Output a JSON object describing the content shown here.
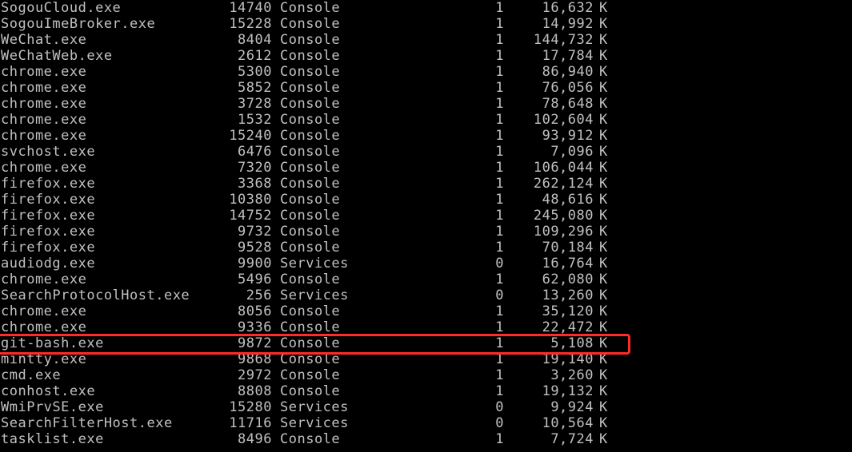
{
  "console": {
    "rows": [
      {
        "name": "SogouCloud.exe",
        "pid": "14740",
        "session": "Console",
        "num": "1",
        "mem": "16,632",
        "unit": "K"
      },
      {
        "name": "SogouImeBroker.exe",
        "pid": "15228",
        "session": "Console",
        "num": "1",
        "mem": "14,992",
        "unit": "K"
      },
      {
        "name": "WeChat.exe",
        "pid": "8404",
        "session": "Console",
        "num": "1",
        "mem": "144,732",
        "unit": "K"
      },
      {
        "name": "WeChatWeb.exe",
        "pid": "2612",
        "session": "Console",
        "num": "1",
        "mem": "17,784",
        "unit": "K"
      },
      {
        "name": "chrome.exe",
        "pid": "5300",
        "session": "Console",
        "num": "1",
        "mem": "86,940",
        "unit": "K"
      },
      {
        "name": "chrome.exe",
        "pid": "5852",
        "session": "Console",
        "num": "1",
        "mem": "76,056",
        "unit": "K"
      },
      {
        "name": "chrome.exe",
        "pid": "3728",
        "session": "Console",
        "num": "1",
        "mem": "78,648",
        "unit": "K"
      },
      {
        "name": "chrome.exe",
        "pid": "1532",
        "session": "Console",
        "num": "1",
        "mem": "102,604",
        "unit": "K"
      },
      {
        "name": "chrome.exe",
        "pid": "15240",
        "session": "Console",
        "num": "1",
        "mem": "93,912",
        "unit": "K"
      },
      {
        "name": "svchost.exe",
        "pid": "6476",
        "session": "Console",
        "num": "1",
        "mem": "7,096",
        "unit": "K"
      },
      {
        "name": "chrome.exe",
        "pid": "7320",
        "session": "Console",
        "num": "1",
        "mem": "106,044",
        "unit": "K"
      },
      {
        "name": "firefox.exe",
        "pid": "3368",
        "session": "Console",
        "num": "1",
        "mem": "262,124",
        "unit": "K"
      },
      {
        "name": "firefox.exe",
        "pid": "10380",
        "session": "Console",
        "num": "1",
        "mem": "48,616",
        "unit": "K"
      },
      {
        "name": "firefox.exe",
        "pid": "14752",
        "session": "Console",
        "num": "1",
        "mem": "245,080",
        "unit": "K"
      },
      {
        "name": "firefox.exe",
        "pid": "9732",
        "session": "Console",
        "num": "1",
        "mem": "109,296",
        "unit": "K"
      },
      {
        "name": "firefox.exe",
        "pid": "9528",
        "session": "Console",
        "num": "1",
        "mem": "70,184",
        "unit": "K"
      },
      {
        "name": "audiodg.exe",
        "pid": "9900",
        "session": "Services",
        "num": "0",
        "mem": "16,764",
        "unit": "K"
      },
      {
        "name": "chrome.exe",
        "pid": "5496",
        "session": "Console",
        "num": "1",
        "mem": "62,080",
        "unit": "K"
      },
      {
        "name": "SearchProtocolHost.exe",
        "pid": "256",
        "session": "Services",
        "num": "0",
        "mem": "13,260",
        "unit": "K"
      },
      {
        "name": "chrome.exe",
        "pid": "8056",
        "session": "Console",
        "num": "1",
        "mem": "35,120",
        "unit": "K"
      },
      {
        "name": "chrome.exe",
        "pid": "9336",
        "session": "Console",
        "num": "1",
        "mem": "22,472",
        "unit": "K"
      },
      {
        "name": "git-bash.exe",
        "pid": "9872",
        "session": "Console",
        "num": "1",
        "mem": "5,108",
        "unit": "K"
      },
      {
        "name": "mintty.exe",
        "pid": "9868",
        "session": "Console",
        "num": "1",
        "mem": "19,140",
        "unit": "K"
      },
      {
        "name": "cmd.exe",
        "pid": "2972",
        "session": "Console",
        "num": "1",
        "mem": "3,260",
        "unit": "K"
      },
      {
        "name": "conhost.exe",
        "pid": "8808",
        "session": "Console",
        "num": "1",
        "mem": "19,132",
        "unit": "K"
      },
      {
        "name": "WmiPrvSE.exe",
        "pid": "15280",
        "session": "Services",
        "num": "0",
        "mem": "9,924",
        "unit": "K"
      },
      {
        "name": "SearchFilterHost.exe",
        "pid": "11716",
        "session": "Services",
        "num": "0",
        "mem": "10,564",
        "unit": "K"
      },
      {
        "name": "tasklist.exe",
        "pid": "8496",
        "session": "Console",
        "num": "1",
        "mem": "7,724",
        "unit": "K"
      }
    ],
    "highlighted_row_index": 21
  },
  "colors": {
    "background": "#000000",
    "text": "#c0c0c0",
    "highlight_box": "#ff2a2a"
  }
}
